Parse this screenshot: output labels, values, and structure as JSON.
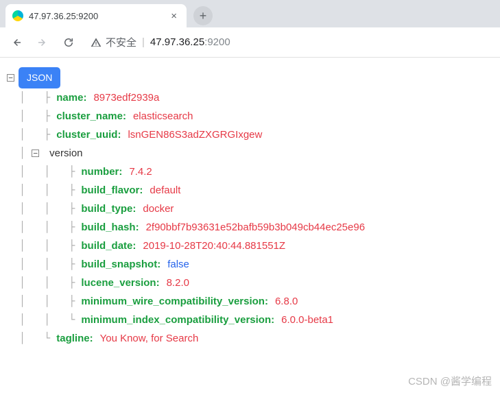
{
  "tab": {
    "title": "47.97.36.25:9200",
    "close": "×",
    "new": "+"
  },
  "toolbar": {
    "insecure_label": "不安全",
    "url_host": "47.97.36.25",
    "url_port": ":9200"
  },
  "json": {
    "badge": "JSON",
    "root": {
      "name": {
        "k": "name",
        "v": "8973edf2939a"
      },
      "cluster_name": {
        "k": "cluster_name",
        "v": "elasticsearch"
      },
      "cluster_uuid": {
        "k": "cluster_uuid",
        "v": "lsnGEN86S3adZXGRGIxgew"
      },
      "version_label": "version",
      "version": {
        "number": {
          "k": "number",
          "v": "7.4.2"
        },
        "build_flavor": {
          "k": "build_flavor",
          "v": "default"
        },
        "build_type": {
          "k": "build_type",
          "v": "docker"
        },
        "build_hash": {
          "k": "build_hash",
          "v": "2f90bbf7b93631e52bafb59b3b049cb44ec25e96"
        },
        "build_date": {
          "k": "build_date",
          "v": "2019-10-28T20:40:44.881551Z"
        },
        "build_snapshot": {
          "k": "build_snapshot",
          "v": "false"
        },
        "lucene_version": {
          "k": "lucene_version",
          "v": "8.2.0"
        },
        "minimum_wire_compatibility_version": {
          "k": "minimum_wire_compatibility_version",
          "v": "6.8.0"
        },
        "minimum_index_compatibility_version": {
          "k": "minimum_index_compatibility_version",
          "v": "6.0.0-beta1"
        }
      },
      "tagline": {
        "k": "tagline",
        "v": "You Know, for Search"
      }
    }
  },
  "watermark": "CSDN @酱学编程"
}
